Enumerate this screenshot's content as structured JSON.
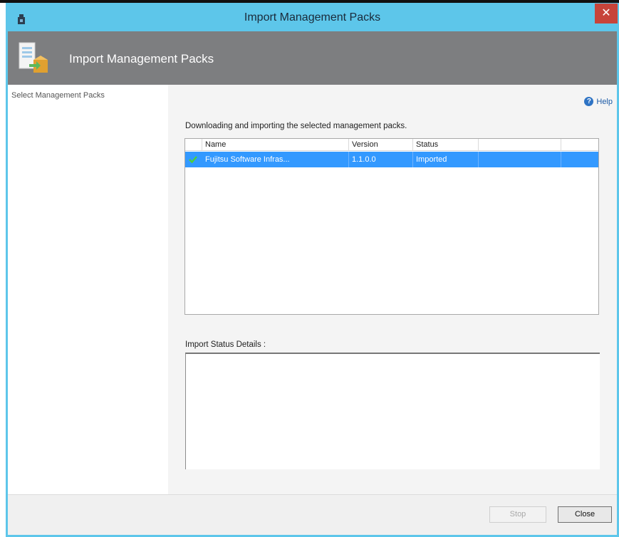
{
  "window": {
    "title": "Import Management Packs"
  },
  "banner": {
    "title": "Import Management Packs"
  },
  "left_pane": {
    "step": "Select Management Packs"
  },
  "help": {
    "label": "Help",
    "icon": "help-icon"
  },
  "description": "Downloading and importing the selected management packs.",
  "table": {
    "columns": [
      "Name",
      "Version",
      "Status",
      "",
      ""
    ],
    "rows": [
      {
        "name": "Fujitsu Software Infras...",
        "version": "1.1.0.0",
        "status": "Imported",
        "icon": "check-icon"
      }
    ]
  },
  "details": {
    "label": "Import Status Details :"
  },
  "buttons": {
    "stop": "Stop",
    "close": "Close"
  },
  "colors": {
    "titlebar": "#5dc6ea",
    "banner": "#7d7e80",
    "selection": "#3399ff",
    "close": "#c7443a"
  }
}
